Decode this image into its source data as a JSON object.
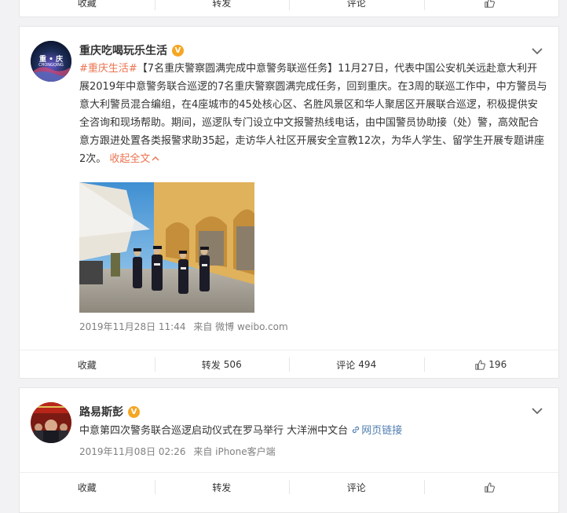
{
  "top_card": {
    "actions": [
      {
        "label": "收藏",
        "count": ""
      },
      {
        "label": "转发",
        "count": ""
      },
      {
        "label": "评论",
        "count": ""
      },
      {
        "label": "",
        "count": ""
      }
    ]
  },
  "post1": {
    "author": "重庆吃喝玩乐生活",
    "verified_badge": "V",
    "avatar_text": "重 • 庆",
    "avatar_subtext": "CHONGQING",
    "hashtag": "#重庆生活#",
    "headline": "【7名重庆警察圆满完成中意警务联巡任务】",
    "body": "11月27日，代表中国公安机关远赴意大利开展2019年中意警务联合巡逻的7名重庆警察圆满完成任务，回到重庆。在3周的联巡工作中，中方警员与意大利警员混合编组，在4座城市的45处核心区、名胜风景区和华人聚居区开展联合巡逻，积极提供安全咨询和现场帮助。期间，巡逻队专门设立中文报警热线电话，由中国警员协助接（处）警，高效配合意方跟进处置各类报警求助35起，走访华人社区开展安全宣教12次，为华人学生、留学生开展专题讲座2次。",
    "collapse_label": "收起全文",
    "timestamp": "2019年11月28日 11:44",
    "source": "来自 微博 weibo.com",
    "actions": [
      {
        "label": "收藏",
        "count": ""
      },
      {
        "label": "转发",
        "count": "506"
      },
      {
        "label": "评论",
        "count": "494"
      },
      {
        "label": "",
        "count": "196"
      }
    ]
  },
  "post2": {
    "author": "路易斯彭",
    "verified_badge": "V",
    "text": "中意第四次警务联合巡逻启动仪式在罗马举行 大洋洲中文台",
    "link_label": "网页链接",
    "timestamp": "2019年11月08日 02:26",
    "source": "来自 iPhone客户端",
    "actions": [
      {
        "label": "收藏",
        "count": ""
      },
      {
        "label": "转发",
        "count": ""
      },
      {
        "label": "评论",
        "count": ""
      },
      {
        "label": "",
        "count": ""
      }
    ]
  },
  "colors": {
    "link": "#eb7350",
    "topic_blue": "#507daf",
    "meta_gray": "#808080",
    "badge": "#f5a623"
  }
}
